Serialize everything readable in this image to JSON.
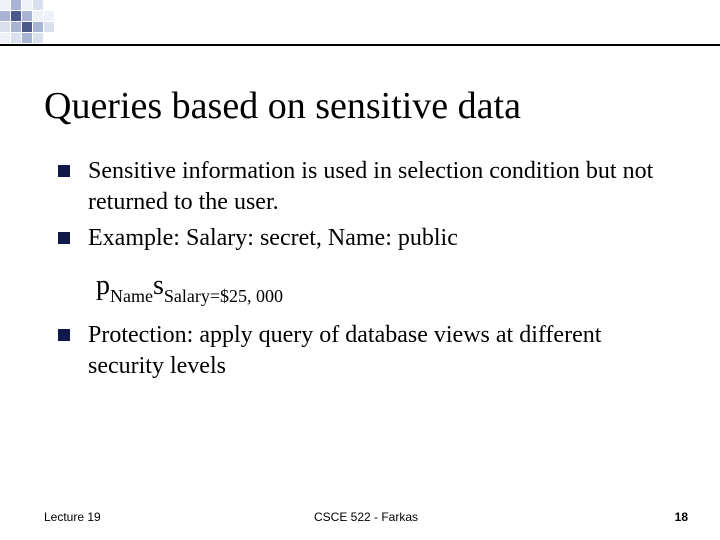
{
  "title": "Queries based on sensitive data",
  "bullets": {
    "b1": "Sensitive information is used in selection condition but not returned to the user.",
    "b2": "Example: Salary: secret, Name: public",
    "b3": "Protection: apply query of database views at different security levels"
  },
  "formula": {
    "pi": "p",
    "sub1": "Name",
    "sigma": "s",
    "sub2": "Salary=$25, 000"
  },
  "footer": {
    "left": "Lecture 19",
    "center": "CSCE 522 - Farkas",
    "right": "18"
  }
}
